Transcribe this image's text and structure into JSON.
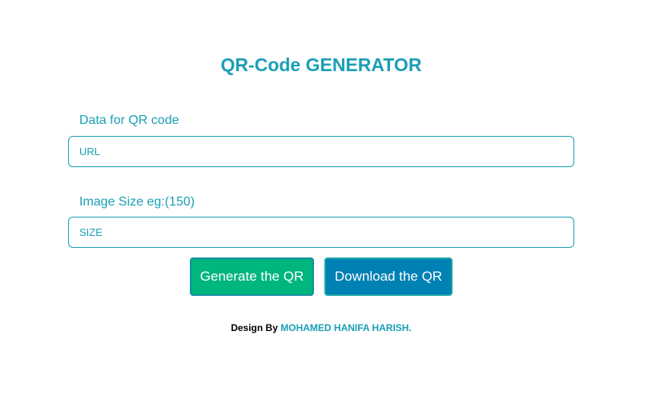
{
  "page": {
    "title": "QR-Code GENERATOR"
  },
  "form": {
    "data_label": "Data for QR code",
    "data_placeholder": "URL",
    "size_label": "Image Size eg:(150)",
    "size_placeholder": "SIZE"
  },
  "actions": {
    "generate_label": "Generate the QR",
    "download_label": "Download the QR"
  },
  "footer": {
    "prefix": "Design By",
    "author": "MOHAMED HANIFA HARISH."
  },
  "colors": {
    "accent": "#1a9fb6",
    "generate_bg": "#00b67f",
    "download_bg": "#0081b4"
  }
}
